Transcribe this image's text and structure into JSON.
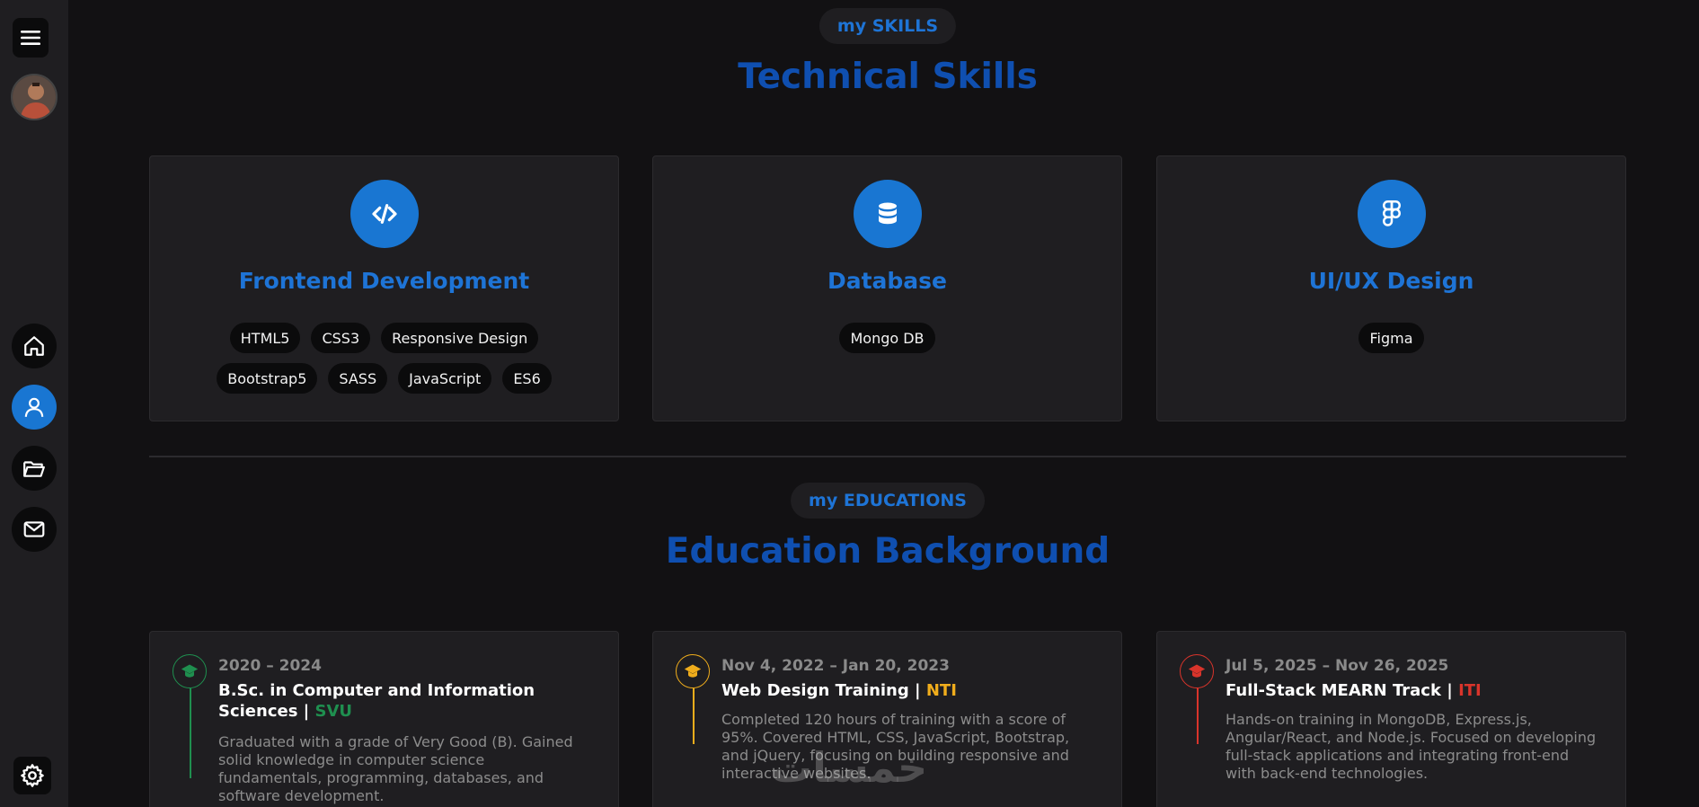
{
  "sidebar": {
    "menu_icon": "hamburger-icon",
    "nav": [
      {
        "icon": "home-icon"
      },
      {
        "icon": "user-icon",
        "active": true
      },
      {
        "icon": "folder-icon"
      },
      {
        "icon": "mail-icon"
      }
    ],
    "settings_icon": "gear-icon"
  },
  "skills": {
    "pill": "my SKILLS",
    "title": "Technical Skills",
    "cards": [
      {
        "icon": "code-icon",
        "title": "Frontend Development",
        "tags": [
          "HTML5",
          "CSS3",
          "Responsive Design",
          "Bootstrap5",
          "SASS",
          "JavaScript",
          "ES6"
        ]
      },
      {
        "icon": "database-icon",
        "title": "Database",
        "tags": [
          "Mongo DB"
        ]
      },
      {
        "icon": "figma-icon",
        "title": "UI/UX Design",
        "tags": [
          "Figma"
        ]
      }
    ]
  },
  "education": {
    "pill": "my EDUCATIONS",
    "title": "Education Background",
    "items": [
      {
        "date": "2020 – 2024",
        "title": "B.Sc. in Computer and Information Sciences | ",
        "org": "SVU",
        "color": "#1f8f4f",
        "desc": "Graduated with a grade of Very Good (B). Gained solid knowledge in computer science fundamentals, programming, databases, and software development."
      },
      {
        "date": "Nov 4, 2022 – Jan 20, 2023",
        "title": "Web Design Training | ",
        "org": "NTI",
        "color": "#f0ad1c",
        "desc": "Completed 120 hours of training with a score of 95%. Covered HTML, CSS, JavaScript, Bootstrap, and jQuery, focusing on building responsive and interactive websites."
      },
      {
        "date": "Jul 5, 2025 – Nov 26, 2025",
        "title": "Full-Stack MEARN Track | ",
        "org": "ITI",
        "color": "#d9342b",
        "desc": "Hands-on training in MongoDB, Express.js, Angular/React, and Node.js. Focused on developing full-stack applications and integrating front-end with back-end technologies."
      }
    ]
  },
  "watermark": "خمسات"
}
